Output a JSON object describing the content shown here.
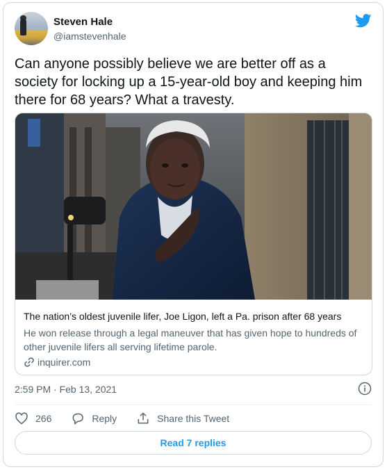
{
  "user": {
    "name": "Steven Hale",
    "handle": "@iamstevenhale",
    "avatar_icon": "user-avatar"
  },
  "tweet": {
    "text": "Can anyone possibly believe we are better off as a society for locking up a 15-year-old boy and keeping him there for 68 years? What a travesty.",
    "timestamp": "2:59 PM · Feb 13, 2021"
  },
  "card": {
    "image_icon": "news-photo",
    "title": "The nation’s oldest juvenile lifer, Joe Ligon, left a Pa. prison after 68 years",
    "description": "He won release through a legal maneuver that has given hope to hundreds of other juvenile lifers all serving lifetime parole.",
    "domain": "inquirer.com"
  },
  "actions": {
    "likes": "266",
    "reply_label": "Reply",
    "share_label": "Share this Tweet"
  },
  "read_replies": "Read 7 replies",
  "colors": {
    "brand_blue": "#1d9bf0",
    "secondary_text": "#536471",
    "border": "#cfd9de"
  }
}
